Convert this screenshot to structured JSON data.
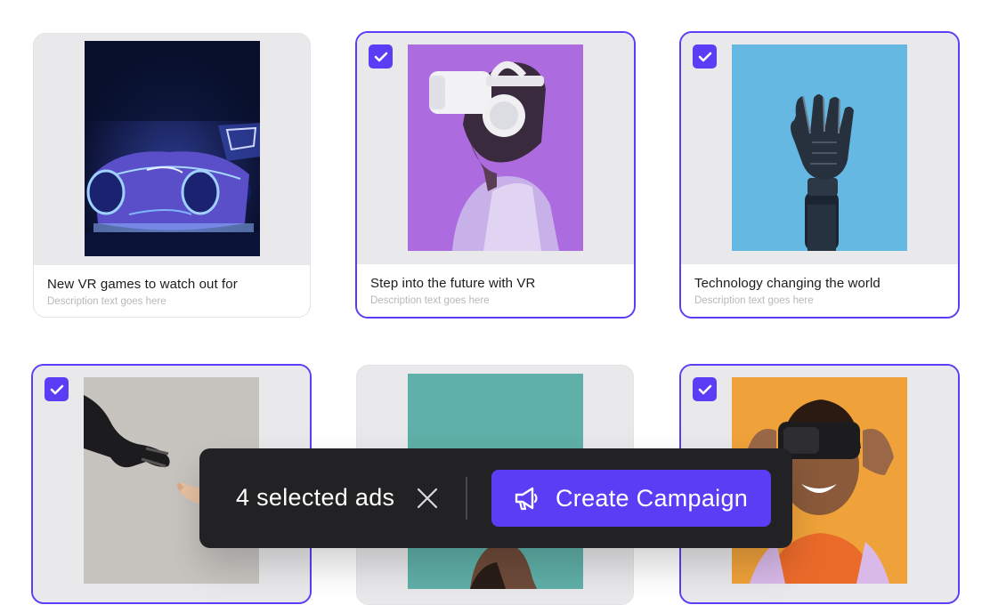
{
  "accent_color": "#5b3df5",
  "cards": [
    {
      "title": "New VR games to watch out for",
      "description": "Description text goes here",
      "selected": false
    },
    {
      "title": "Step into the future with VR",
      "description": "Description text goes here",
      "selected": true
    },
    {
      "title": "Technology changing the world",
      "description": "Description text goes here",
      "selected": true
    },
    {
      "title": "",
      "description": "",
      "selected": true
    },
    {
      "title": "",
      "description": "",
      "selected": false
    },
    {
      "title": "",
      "description": "",
      "selected": true
    }
  ],
  "toolbar": {
    "selected_label": "4 selected ads",
    "clear_icon": "close-icon",
    "create_label": "Create Campaign",
    "create_icon": "megaphone-icon"
  }
}
